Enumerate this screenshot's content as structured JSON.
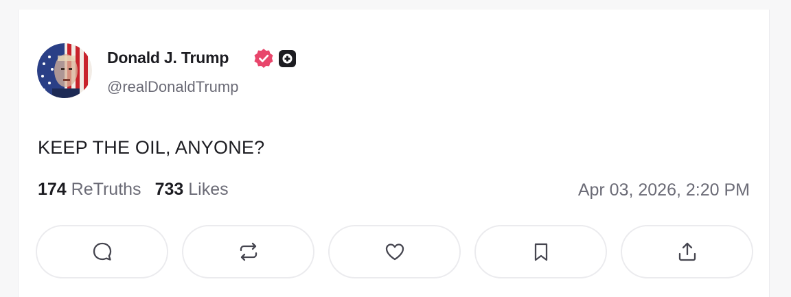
{
  "post": {
    "author": {
      "name": "Donald J. Trump",
      "handle": "@realDonaldTrump",
      "avatar_icon": "american-flag-portrait-avatar"
    },
    "text": "KEEP THE OIL, ANYONE?",
    "stats": {
      "retruths_count": "174",
      "retruths_label": "ReTruths",
      "likes_count": "733",
      "likes_label": "Likes"
    },
    "timestamp": "Apr 03, 2026, 2:20 PM"
  },
  "actions": [
    {
      "icon": "comment-icon"
    },
    {
      "icon": "retruth-icon"
    },
    {
      "icon": "heart-icon"
    },
    {
      "icon": "bookmark-icon"
    },
    {
      "icon": "share-icon"
    }
  ],
  "colors": {
    "verified_badge": "#e8466b",
    "plus_badge": "#1c1c21",
    "text_primary": "#1c1c21",
    "text_secondary": "#6b6b76",
    "button_border": "#ebebee"
  }
}
